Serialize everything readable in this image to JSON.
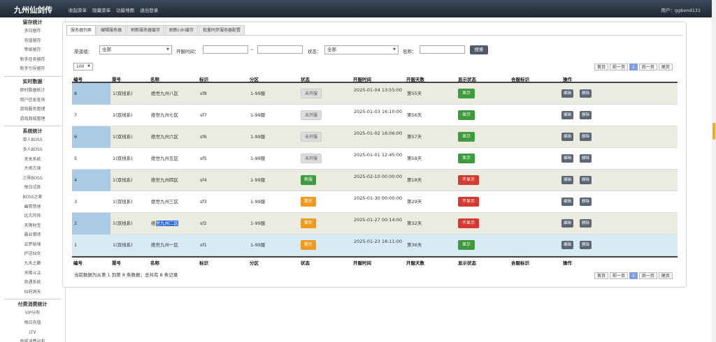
{
  "app": {
    "title": "九州仙剑传",
    "user": "用户：ggbond131"
  },
  "topmenu": [
    "收起菜单",
    "隐藏菜单",
    "功能地图",
    "退出登录"
  ],
  "sidebar": {
    "groups": [
      {
        "title": "留存统计",
        "items": [
          "多日留存",
          "充值留存",
          "等级留存",
          "新手任务留存",
          "新手引导留存"
        ]
      },
      {
        "title": "实时数据",
        "items": [
          "即时数据统计",
          "用户信息查询",
          "游戏服务管理",
          "游戏商城管理"
        ]
      },
      {
        "title": "系统统计",
        "items": [
          "单人BOSS",
          "多人BOSS",
          "天关系统",
          "大闹古境",
          "三界BOSS",
          "每日试炼",
          "BOSS之家",
          "幽冥禁地",
          "远古符阵",
          "天降财宝",
          "霸业猎场",
          "云梦秘境",
          "护送仙女",
          "九天之巅",
          "天梯斗法",
          "奇遇系统",
          "仙府洞天"
        ]
      },
      {
        "title": "付费消费统计",
        "items": [
          "VIP分布",
          "每日充值",
          "LTV",
          "商城消费分布"
        ]
      }
    ]
  },
  "tabs": [
    "服务器列表",
    "编辑服务器",
    "刷新服务器缓存",
    "刷新cdn缓存",
    "批量同步服务器配置"
  ],
  "filter": {
    "channel_label": "渠道组：",
    "channel_value": "全部",
    "time_label": "开服时间：",
    "time_sep": "~",
    "status_label": "状态：",
    "status_value": "全部",
    "name_label": "名称：",
    "search_label": "搜索",
    "page_size": "100"
  },
  "pager": {
    "first": "首页",
    "prev": "前一页",
    "current": "1",
    "next": "后一页",
    "last": "尾页"
  },
  "table": {
    "headers": [
      "编号",
      "渠号",
      "名称",
      "标识",
      "分区",
      "状态",
      "开服时间",
      "开服天数",
      "显示状态",
      "合服标识",
      "操作"
    ],
    "rows": [
      {
        "id": "8",
        "channel": "1(双线系)",
        "name": "绝世九州八区",
        "flag": "sf8",
        "zone": "1-99服",
        "status": "未开服",
        "status_color": "gray",
        "open_time": "2025-01-04 13:55:00",
        "days": "第55天",
        "display": "显示",
        "display_color": "green"
      },
      {
        "id": "7",
        "channel": "1(双线系)",
        "name": "绝世九州七区",
        "flag": "sf7",
        "zone": "1-99服",
        "status": "未开服",
        "status_color": "gray",
        "open_time": "2025-01-03 16:10:00",
        "days": "第56天",
        "display": "显示",
        "display_color": "green"
      },
      {
        "id": "6",
        "channel": "1(双线系)",
        "name": "绝世九州六区",
        "flag": "sf6",
        "zone": "1-99服",
        "status": "未开服",
        "status_color": "gray",
        "open_time": "2025-01-02 16:06:00",
        "days": "第57天",
        "display": "显示",
        "display_color": "green"
      },
      {
        "id": "5",
        "channel": "1(双线系)",
        "name": "绝世九州五区",
        "flag": "sf5",
        "zone": "1-99服",
        "status": "未开服",
        "status_color": "gray",
        "open_time": "2025-01-01 12:45:00",
        "days": "第58天",
        "display": "显示",
        "display_color": "green"
      },
      {
        "id": "4",
        "channel": "1(双线系)",
        "name": "绝世九州四区",
        "flag": "sf4",
        "zone": "1-99服",
        "status": "新服",
        "status_color": "green",
        "open_time": "2025-02-10 00:00:00",
        "days": "第18天",
        "display": "不显示",
        "display_color": "red"
      },
      {
        "id": "3",
        "channel": "1(双线系)",
        "name": "绝世九州三区",
        "flag": "sf3",
        "zone": "1-99服",
        "status": "繁忙",
        "status_color": "orange",
        "open_time": "2025-01-30 00:00:00",
        "days": "第29天",
        "display": "不显示",
        "display_color": "red"
      },
      {
        "id": "2",
        "channel": "1(双线系)",
        "name_pre": "绝",
        "name_sel": "世九州二区",
        "flag": "sf2",
        "zone": "1-99服",
        "status": "繁忙",
        "status_color": "orange",
        "open_time": "2025-01-27 00:14:00",
        "days": "第32天",
        "display": "不显示",
        "display_color": "red"
      },
      {
        "id": "1",
        "channel": "1(双线系)",
        "name": "绝世九州一区",
        "flag": "sf1",
        "zone": "1-99服",
        "status": "繁忙",
        "status_color": "orange",
        "open_time": "2025-01-23 18:11:00",
        "days": "第36天",
        "display": "显示",
        "display_color": "green"
      }
    ],
    "edit_label": "编辑",
    "delete_label": "删除"
  },
  "info": "当前数据为从第 1 到第 8 条数据；总共有 8 条记录"
}
